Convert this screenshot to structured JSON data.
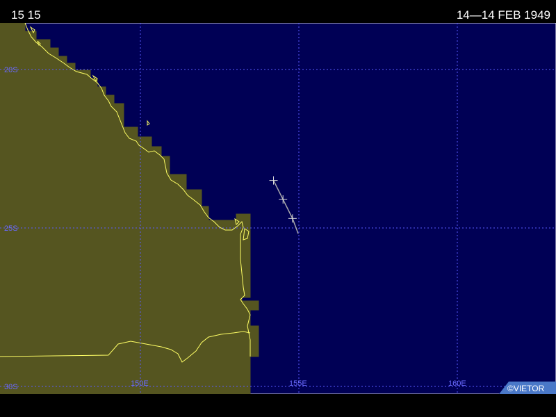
{
  "header": {
    "left_text": "15 15",
    "right_text": "14—14 FEB 1949"
  },
  "map": {
    "ocean_color": "#000055",
    "land_color": "#555520",
    "coast_color": "#ffff66",
    "grid_color": "#5a5aff",
    "lat_labels": [
      "20S",
      "25S",
      "30S"
    ],
    "lon_labels": [
      "150E",
      "155E",
      "160E"
    ],
    "credit": "©VIETOR"
  },
  "track": {
    "color": "#aaaaaa",
    "points": [
      {
        "lat": -23.5,
        "lon": 154.2
      },
      {
        "lat": -24.1,
        "lon": 154.5
      },
      {
        "lat": -24.7,
        "lon": 154.8
      }
    ]
  }
}
